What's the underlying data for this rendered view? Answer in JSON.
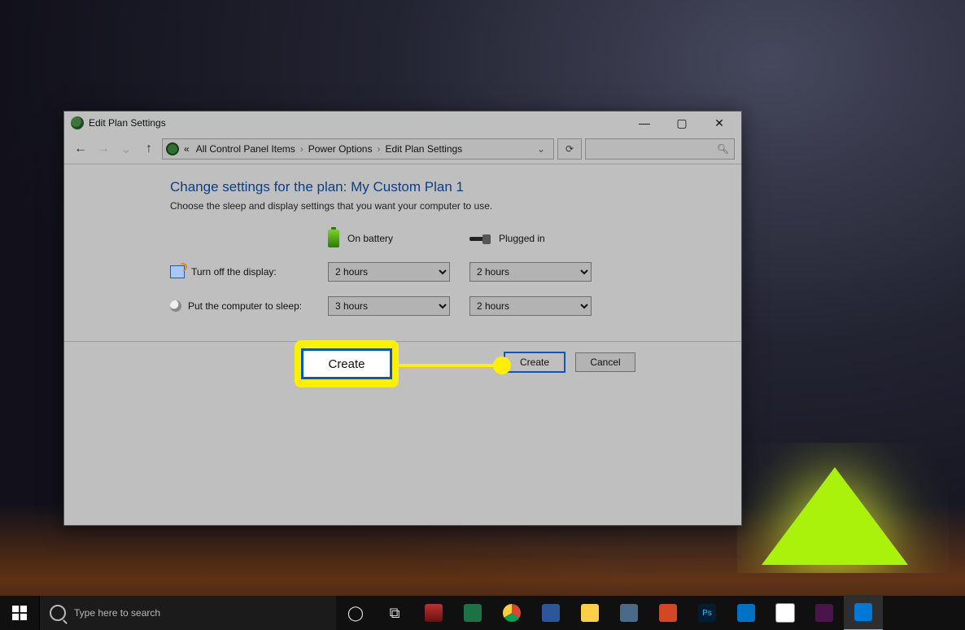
{
  "window": {
    "title": "Edit Plan Settings",
    "breadcrumbs": {
      "prefix": "«",
      "items": [
        "All Control Panel Items",
        "Power Options",
        "Edit Plan Settings"
      ]
    }
  },
  "page": {
    "heading": "Change settings for the plan: My Custom Plan 1",
    "subtext": "Choose the sleep and display settings that you want your computer to use.",
    "col_battery": "On battery",
    "col_plugged": "Plugged in",
    "row_display": "Turn off the display:",
    "row_sleep": "Put the computer to sleep:",
    "display_battery": "2 hours",
    "display_plugged": "2 hours",
    "sleep_battery": "3 hours",
    "sleep_plugged": "2 hours"
  },
  "buttons": {
    "create": "Create",
    "cancel": "Cancel"
  },
  "annotation": {
    "callout": "Create"
  },
  "taskbar": {
    "search_placeholder": "Type here to search",
    "apps": [
      "cortana",
      "task-view",
      "snip",
      "excel",
      "chrome",
      "word",
      "explorer",
      "copy",
      "ppt",
      "photoshop",
      "mail",
      "paint",
      "slack",
      "settings"
    ]
  }
}
